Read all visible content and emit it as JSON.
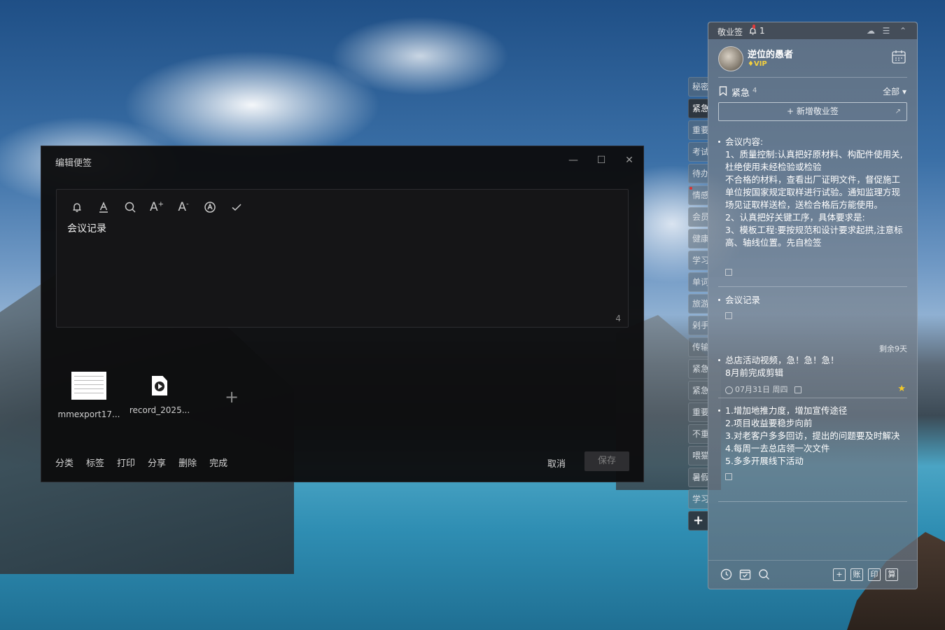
{
  "editor": {
    "title": "编辑便签",
    "content_text": "会议记录",
    "char_count": "4",
    "attachments": [
      {
        "name": "mmexport17...",
        "type": "image"
      },
      {
        "name": "record_2025...",
        "type": "video"
      }
    ],
    "footer_links": [
      "分类",
      "标签",
      "打印",
      "分享",
      "删除",
      "完成"
    ],
    "cancel_label": "取消",
    "save_label": "保存"
  },
  "sidetabs": [
    "秘密",
    "紧急",
    "重要",
    "考试",
    "待办",
    "情感",
    "会员",
    "健康",
    "学习",
    "单词",
    "旅游",
    "剁手",
    "传输",
    "紧急",
    "紧急",
    "重要",
    "不重",
    "喂猫",
    "暑假",
    "学习"
  ],
  "panel": {
    "app_name": "敬业签",
    "notification_count": "1",
    "username": "逆位的愚者",
    "vip_label": "VIP",
    "category_name": "紧急",
    "category_count": "4",
    "filter_label": "全部",
    "new_note_label": "新增敬业签",
    "notes": [
      {
        "text": "会议内容:\n1、质量控制:认真把好原材料、构配件使用关,杜绝使用未经检验或检验\n不合格的材料，查看出厂证明文件，督促施工单位按国家规定取样进行试验。通知监理方现场见证取样送检，送检合格后方能使用。\n2、认真把好关键工序，具体要求是:\n3、模板工程:要按规范和设计要求起拱,注意标高、轴线位置。先自检签"
      },
      {
        "text": "会议记录"
      },
      {
        "text": "总店活动视频，急！急！急！\n8月前完成剪辑",
        "remaining": "剩余9天",
        "date": "07月31日 周四"
      },
      {
        "text": "1.增加地推力度，增加宣传途径\n2.项目收益要稳步向前\n3.对老客户多多回访，提出的问题要及时解决\n4.每周一去总店领一次文件\n5.多多开展线下活动"
      }
    ],
    "bottom_boxes": [
      "+",
      "账",
      "印",
      "算"
    ]
  },
  "colors": {
    "accent_star": "#f3c928",
    "vip_gold": "#f4d03f",
    "notification_red": "#e23b3b"
  }
}
